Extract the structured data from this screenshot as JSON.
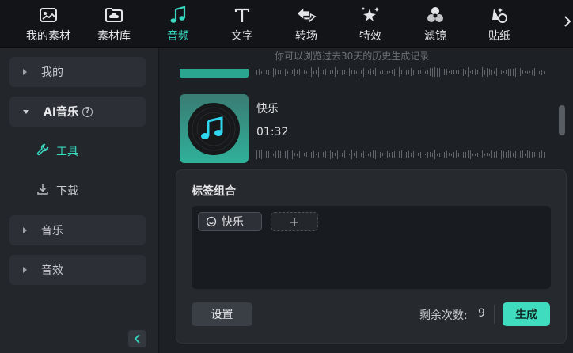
{
  "toolbar": {
    "items": [
      {
        "label": "我的素材",
        "icon": "image-folder-icon"
      },
      {
        "label": "素材库",
        "icon": "cloud-folder-icon"
      },
      {
        "label": "音频",
        "icon": "music-note-icon"
      },
      {
        "label": "文字",
        "icon": "text-t-icon"
      },
      {
        "label": "转场",
        "icon": "transition-arrows-icon"
      },
      {
        "label": "特效",
        "icon": "sparkle-star-icon"
      },
      {
        "label": "滤镜",
        "icon": "filter-circles-icon"
      },
      {
        "label": "贴纸",
        "icon": "sticker-icon"
      }
    ],
    "active_index": 2,
    "more_icon": "chevron-right-icon"
  },
  "sidebar": {
    "sections": [
      {
        "label": "我的"
      },
      {
        "label": "AI音乐",
        "help": "?"
      },
      {
        "label": "音乐"
      },
      {
        "label": "音效"
      }
    ],
    "sub_items": [
      {
        "label": "工具",
        "icon": "wrench-icon"
      },
      {
        "label": "下载",
        "icon": "download-icon"
      }
    ],
    "collapse_icon": "chevron-left-icon"
  },
  "history": {
    "hint": "你可以浏览过去30天的历史生成记录",
    "track": {
      "name": "快乐",
      "duration": "01:32",
      "icon": "vinyl-music-icon"
    }
  },
  "tags": {
    "title": "标签组合",
    "chips": [
      {
        "label": "快乐",
        "icon": "emotion-tag-icon"
      }
    ],
    "add_label": "+"
  },
  "footer": {
    "settings_label": "设置",
    "remaining_label": "剩余次数:",
    "remaining_count": "9",
    "generate_label": "生成"
  },
  "colors": {
    "accent": "#37d9c0",
    "generate_button": "#3fdcc0"
  }
}
